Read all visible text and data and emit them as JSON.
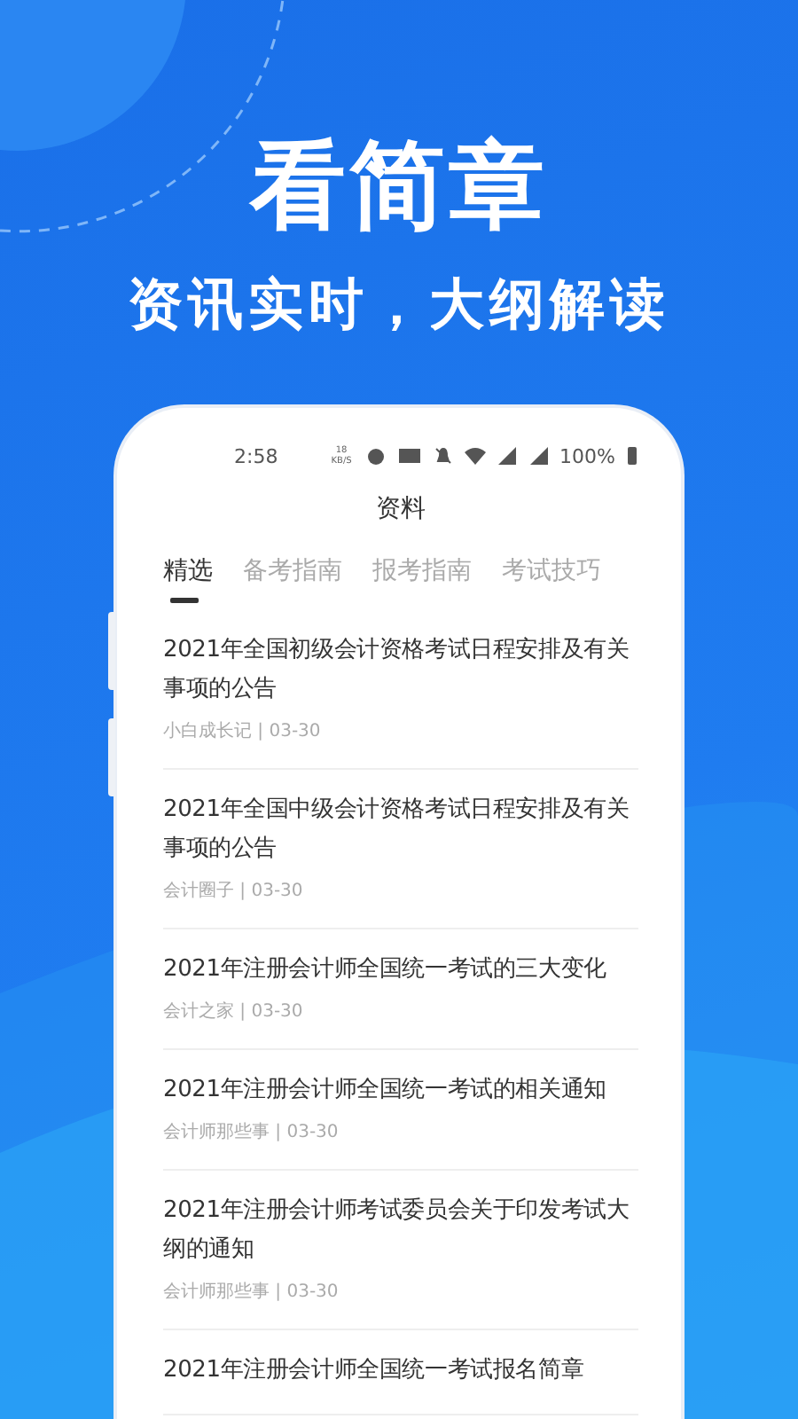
{
  "headline": "看简章",
  "subtitle": "资讯实时，大纲解读",
  "status_bar": {
    "time": "2:58",
    "net_speed": "18 KB/S",
    "battery": "100%"
  },
  "screen_title": "资料",
  "tabs": [
    {
      "label": "精选",
      "selected": true
    },
    {
      "label": "备考指南",
      "selected": false
    },
    {
      "label": "报考指南",
      "selected": false
    },
    {
      "label": "考试技巧",
      "selected": false
    }
  ],
  "articles": [
    {
      "title": "2021年全国初级会计资格考试日程安排及有关事项的公告",
      "meta": "小白成长记 | 03-30"
    },
    {
      "title": "2021年全国中级会计资格考试日程安排及有关事项的公告",
      "meta": "会计圈子 | 03-30"
    },
    {
      "title": "2021年注册会计师全国统一考试的三大变化",
      "meta": "会计之家 | 03-30"
    },
    {
      "title": "2021年注册会计师全国统一考试的相关通知",
      "meta": "会计师那些事 | 03-30"
    },
    {
      "title": "2021年注册会计师考试委员会关于印发考试大纲的通知",
      "meta": "会计师那些事 | 03-30"
    },
    {
      "title": "2021年注册会计师全国统一考试报名简章"
    }
  ]
}
